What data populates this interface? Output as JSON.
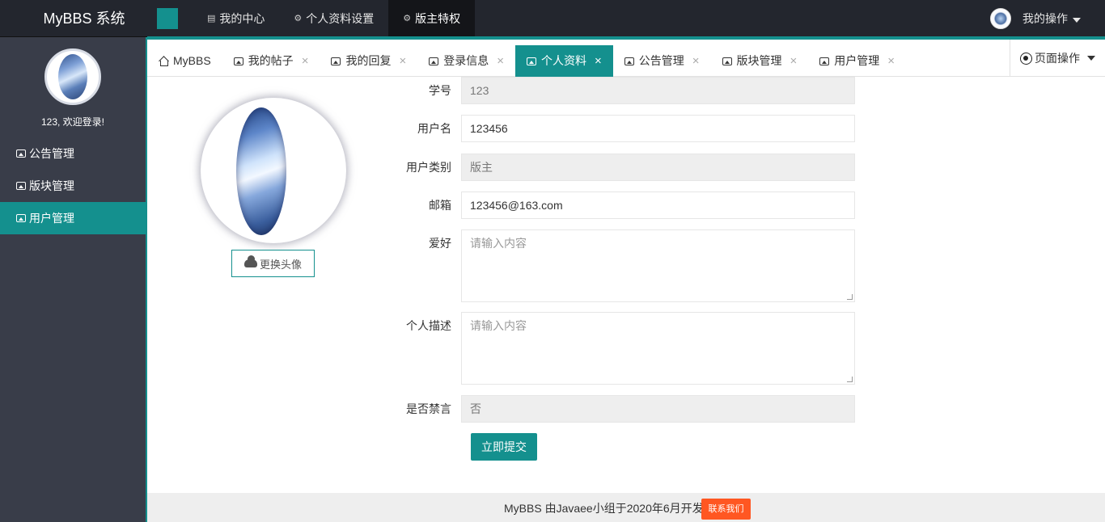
{
  "header": {
    "logo": "MyBBS 系统",
    "nav": [
      {
        "label": "我的中心",
        "icon": "document-icon"
      },
      {
        "label": "个人资料设置",
        "icon": "gear-icon"
      },
      {
        "label": "版主特权",
        "icon": "gear-icon"
      }
    ],
    "user_menu": "我的操作"
  },
  "sidebar": {
    "welcome": "123, 欢迎登录!",
    "items": [
      {
        "label": "公告管理"
      },
      {
        "label": "版块管理"
      },
      {
        "label": "用户管理"
      }
    ]
  },
  "tabs": [
    {
      "label": "MyBBS"
    },
    {
      "label": "我的帖子"
    },
    {
      "label": "我的回复"
    },
    {
      "label": "登录信息"
    },
    {
      "label": "个人资料"
    },
    {
      "label": "公告管理"
    },
    {
      "label": "版块管理"
    },
    {
      "label": "用户管理"
    }
  ],
  "page_ops": "页面操作",
  "profile": {
    "change_avatar": "更换头像",
    "fields": {
      "student_id": {
        "label": "学号",
        "value": "123"
      },
      "username": {
        "label": "用户名",
        "value": "123456"
      },
      "user_type": {
        "label": "用户类别",
        "value": "版主"
      },
      "email": {
        "label": "邮箱",
        "value": "123456@163.com"
      },
      "hobby": {
        "label": "爱好",
        "placeholder": "请输入内容"
      },
      "description": {
        "label": "个人描述",
        "placeholder": "请输入内容"
      },
      "banned": {
        "label": "是否禁言",
        "value": "否"
      }
    },
    "submit": "立即提交"
  },
  "footer": {
    "text": "MyBBS 由Javaee小组于2020年6月开发",
    "contact": "联系我们"
  },
  "colors": {
    "accent": "#14908e",
    "header_bg": "#23262e",
    "sidebar_bg": "#393d49",
    "contact_btn": "#ff5722"
  }
}
